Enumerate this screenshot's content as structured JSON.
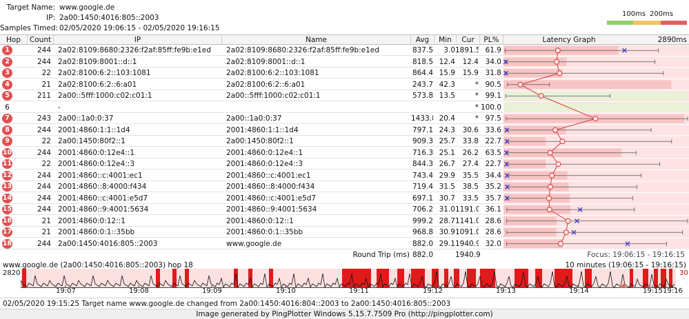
{
  "header": {
    "target_label": "Target Name:",
    "target_value": "www.google.de",
    "ip_label": "IP:",
    "ip_value": "2a00:1450:4016:805::2003",
    "samples_label": "Samples Timed:",
    "samples_value": "02/05/2020 19:06:15 - 02/05/2020 19:16:15"
  },
  "scale": {
    "label_100": "100ms",
    "label_200": "200ms",
    "colors": [
      "#8fcf6a",
      "#f2c463",
      "#e0615d"
    ]
  },
  "columns": {
    "hop": "Hop",
    "count": "Count",
    "ip": "IP",
    "name": "Name",
    "avg": "Avg",
    "min": "Min",
    "cur": "Cur",
    "pl": "PL%",
    "graph": "Latency Graph",
    "graph_max": "2890ms"
  },
  "hops": [
    {
      "hop": "1",
      "count": "244",
      "ip": "2a02:8109:8680:2326:f2af:85ff:fe9b:e1ed",
      "name": "2a02:8109:8680:2326:f2af:85ff:fe9b:e1ed",
      "avg": "837.5",
      "min": "3.0",
      "cur": "1891.5",
      "pl": "61.9",
      "badge": true
    },
    {
      "hop": "2",
      "count": "244",
      "ip": "2a02:8109:8001::d::1",
      "name": "2a02:8109:8001::d::1",
      "avg": "818.5",
      "min": "12.4",
      "cur": "12.4",
      "pl": "34.0",
      "badge": true
    },
    {
      "hop": "3",
      "count": "22",
      "ip": "2a02:8100:6:2::103:1081",
      "name": "2a02:8100:6:2::103:1081",
      "avg": "864.4",
      "min": "15.9",
      "cur": "15.9",
      "pl": "31.8",
      "badge": true
    },
    {
      "hop": "4",
      "count": "21",
      "ip": "2a02:8100:6:2::6:a01",
      "name": "2a02:8100:6:2::6:a01",
      "avg": "243.7",
      "min": "42.3",
      "cur": "*",
      "pl": "90.5",
      "badge": true
    },
    {
      "hop": "5",
      "count": "211",
      "ip": "2a00::5fff:1000:c02:c01:1",
      "name": "2a00::5fff:1000:c02:c01:1",
      "avg": "573.8",
      "min": "13.5",
      "cur": "*",
      "pl": "99.1",
      "badge": true
    },
    {
      "hop": "6",
      "count": "",
      "ip": "-",
      "name": "",
      "avg": "",
      "min": "",
      "cur": "*",
      "pl": "100.0",
      "badge": false
    },
    {
      "hop": "7",
      "count": "243",
      "ip": "2a00::1a0:0:37",
      "name": "2a00::1a0:0:37",
      "avg": "1433.8",
      "min": "20.4",
      "cur": "*",
      "pl": "97.5",
      "badge": true
    },
    {
      "hop": "8",
      "count": "244",
      "ip": "2001:4860:1:1::1d4",
      "name": "2001:4860:1:1::1d4",
      "avg": "797.1",
      "min": "24.3",
      "cur": "30.6",
      "pl": "33.6",
      "badge": true
    },
    {
      "hop": "9",
      "count": "22",
      "ip": "2a00:1450:80f2::1",
      "name": "2a00:1450:80f2::1",
      "avg": "909.3",
      "min": "25.7",
      "cur": "33.8",
      "pl": "22.7",
      "badge": true
    },
    {
      "hop": "10",
      "count": "244",
      "ip": "2001:4860:0:12e4::1",
      "name": "2001:4860:0:12e4::1",
      "avg": "716.3",
      "min": "25.1",
      "cur": "26.2",
      "pl": "63.5",
      "badge": true
    },
    {
      "hop": "11",
      "count": "22",
      "ip": "2001:4860:0:12e4::3",
      "name": "2001:4860:0:12e4::3",
      "avg": "844.3",
      "min": "26.7",
      "cur": "27.4",
      "pl": "22.7",
      "badge": true
    },
    {
      "hop": "12",
      "count": "244",
      "ip": "2001:4860::c:4001:ec1",
      "name": "2001:4860::c:4001:ec1",
      "avg": "743.4",
      "min": "29.9",
      "cur": "35.5",
      "pl": "34.4",
      "badge": true
    },
    {
      "hop": "13",
      "count": "244",
      "ip": "2001:4860::8:4000:f434",
      "name": "2001:4860::8:4000:f434",
      "avg": "719.4",
      "min": "31.5",
      "cur": "38.5",
      "pl": "35.2",
      "badge": true
    },
    {
      "hop": "14",
      "count": "244",
      "ip": "2001:4860::c:4001:e5d7",
      "name": "2001:4860::c:4001:e5d7",
      "avg": "697.1",
      "min": "30.7",
      "cur": "33.5",
      "pl": "35.7",
      "badge": true
    },
    {
      "hop": "15",
      "count": "244",
      "ip": "2001:4860::9:4001:5634",
      "name": "2001:4860::9:4001:5634",
      "avg": "706.2",
      "min": "31.0",
      "cur": "1191.0",
      "pl": "36.1",
      "badge": true
    },
    {
      "hop": "16",
      "count": "21",
      "ip": "2001:4860:0:12::1",
      "name": "2001:4860:0:12::1",
      "avg": "999.2",
      "min": "28.7",
      "cur": "1141.0",
      "pl": "28.6",
      "badge": true
    },
    {
      "hop": "17",
      "count": "21",
      "ip": "2001:4860:0:1::35bb",
      "name": "2001:4860:0:1::35bb",
      "avg": "968.8",
      "min": "30.9",
      "cur": "1091.0",
      "pl": "28.6",
      "badge": true
    },
    {
      "hop": "18",
      "count": "244",
      "ip": "2a00:1450:4016:805::2003",
      "name": "www.google.de",
      "avg": "882.0",
      "min": "29.1",
      "cur": "1940.9",
      "pl": "32.0",
      "badge": true
    }
  ],
  "round_trip": {
    "label": "Round Trip (ms)",
    "avg": "882.0",
    "cur": "1940.9",
    "focus": "Focus: 19:06:15 - 19:16:15"
  },
  "timeline": {
    "title": "www.google.de (2a00:1450:4016:805::2003) hop 18",
    "range": "10 minutes (19:06:15 - 19:16:15)",
    "y_max": "2820",
    "y_right": "30",
    "ticks": [
      "19:07",
      "19:08",
      "19:09",
      "19:10",
      "19:11",
      "19:12",
      "19:13",
      "19:14",
      "19:15",
      "19:16"
    ]
  },
  "status": "02/05/2020 19:15:25 Target name www.google.de changed from 2a00:1450:4016:804::2003 to 2a00:1450:4016:805::2003",
  "credit": "Image generated by PingPlotter Windows 5.15.7.7509 Pro (http://pingplotter.com)"
}
